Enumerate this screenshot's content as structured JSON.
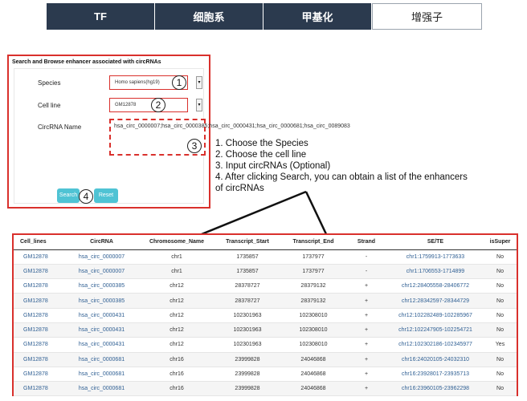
{
  "tabs": [
    "TF",
    "细胞系",
    "甲基化",
    "增强子"
  ],
  "panel": {
    "title": "Search and Browse enhancer associated with circRNAs",
    "species_label": "Species",
    "species_value": "Homo sapiens(hg19)",
    "cell_line_label": "Cell line",
    "cell_line_value": "GM12878",
    "circrna_label": "CircRNA Name",
    "circrna_value": "hsa_circ_0000007;hsa_circ_0000385;hsa_circ_0000431;hsa_circ_0000681;hsa_circ_0089083",
    "search_label": "Search",
    "reset_label": "Reset",
    "markers": [
      "1",
      "2",
      "3",
      "4"
    ]
  },
  "instructions": [
    "1. Choose the Species",
    "2. Choose the cell line",
    "3. Input circRNAs (Optional)",
    "4. After clicking Search, you can obtain a list of the enhancers",
    "of circRNAs"
  ],
  "table": {
    "headers": [
      "Cell_lines",
      "CircRNA",
      "Chromosome_Name",
      "Transcript_Start",
      "Transcript_End",
      "Strand",
      "SE/TE",
      "isSuper"
    ],
    "rows": [
      [
        "GM12878",
        "hsa_circ_0000007",
        "chr1",
        "1735857",
        "1737977",
        "-",
        "chr1:1759913-1773633",
        "No"
      ],
      [
        "GM12878",
        "hsa_circ_0000007",
        "chr1",
        "1735857",
        "1737977",
        "-",
        "chr1:1706553-1714899",
        "No"
      ],
      [
        "GM12878",
        "hsa_circ_0000385",
        "chr12",
        "28378727",
        "28379132",
        "+",
        "chr12:28405558-28406772",
        "No"
      ],
      [
        "GM12878",
        "hsa_circ_0000385",
        "chr12",
        "28378727",
        "28379132",
        "+",
        "chr12:28342597-28344729",
        "No"
      ],
      [
        "GM12878",
        "hsa_circ_0000431",
        "chr12",
        "102301963",
        "102308010",
        "+",
        "chr12:102282489-102285967",
        "No"
      ],
      [
        "GM12878",
        "hsa_circ_0000431",
        "chr12",
        "102301963",
        "102308010",
        "+",
        "chr12:102247905-102254721",
        "No"
      ],
      [
        "GM12878",
        "hsa_circ_0000431",
        "chr12",
        "102301963",
        "102308010",
        "+",
        "chr12:102302186-102345977",
        "Yes"
      ],
      [
        "GM12878",
        "hsa_circ_0000681",
        "chr16",
        "23999828",
        "24046868",
        "+",
        "chr16:24020105-24032310",
        "No"
      ],
      [
        "GM12878",
        "hsa_circ_0000681",
        "chr16",
        "23999828",
        "24046868",
        "+",
        "chr16:23928017-23935713",
        "No"
      ],
      [
        "GM12878",
        "hsa_circ_0000681",
        "chr16",
        "23999828",
        "24046868",
        "+",
        "chr16:23960105-23962298",
        "No"
      ]
    ]
  },
  "icons": {
    "dropdown": "chevron-down-icon"
  },
  "colors": {
    "tab_dark": "#2b3a4e",
    "highlight_red": "#d9302c",
    "button_cyan": "#4fc3d4",
    "link_blue": "#2f5f93"
  }
}
